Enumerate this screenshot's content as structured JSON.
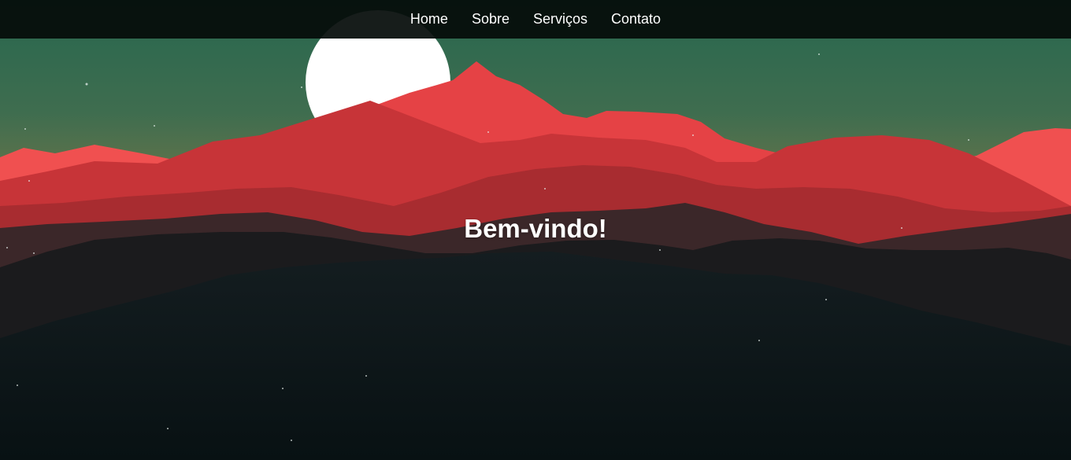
{
  "nav": {
    "items": [
      {
        "label": "Home"
      },
      {
        "label": "Sobre"
      },
      {
        "label": "Serviços"
      },
      {
        "label": "Contato"
      }
    ]
  },
  "hero": {
    "headline": "Bem-vindo!",
    "background": "mountain-landscape-illustration",
    "colors": {
      "sky_top": "#2b6a52",
      "sky_bottom": "#7a7a45",
      "moon": "#ffffff",
      "mountain_bright": "#e84448",
      "mountain_mid": "#c63538",
      "mountain_dark": "#1c1a1c",
      "foreground": "#0b1416"
    }
  }
}
